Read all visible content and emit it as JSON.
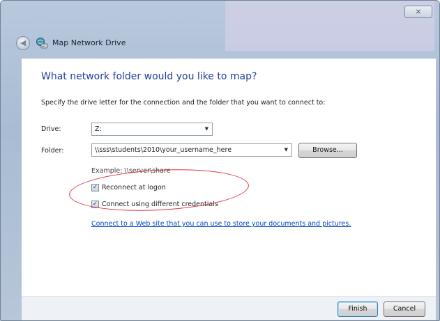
{
  "window": {
    "title": "Map Network Drive",
    "close_label": "⨯"
  },
  "dialog": {
    "heading": "What network folder would you like to map?",
    "instruction": "Specify the drive letter for the connection and the folder that you want to connect to:",
    "drive_label": "Drive:",
    "drive_value": "Z:",
    "folder_label": "Folder:",
    "folder_value": "\\\\sss\\students\\2010\\your_username_here",
    "browse_label": "Browse...",
    "example_text": "Example: \\\\server\\share",
    "reconnect_label": "Reconnect at logon",
    "reconnect_checked": true,
    "credentials_label": "Connect using different credentials",
    "credentials_checked": true,
    "link_text": "Connect to a Web site that you can use to store your documents and pictures."
  },
  "footer": {
    "finish_label": "Finish",
    "cancel_label": "Cancel"
  },
  "colors": {
    "heading": "#1f3f9e",
    "link": "#0645c4",
    "highlight_ellipse": "#d9363e"
  }
}
